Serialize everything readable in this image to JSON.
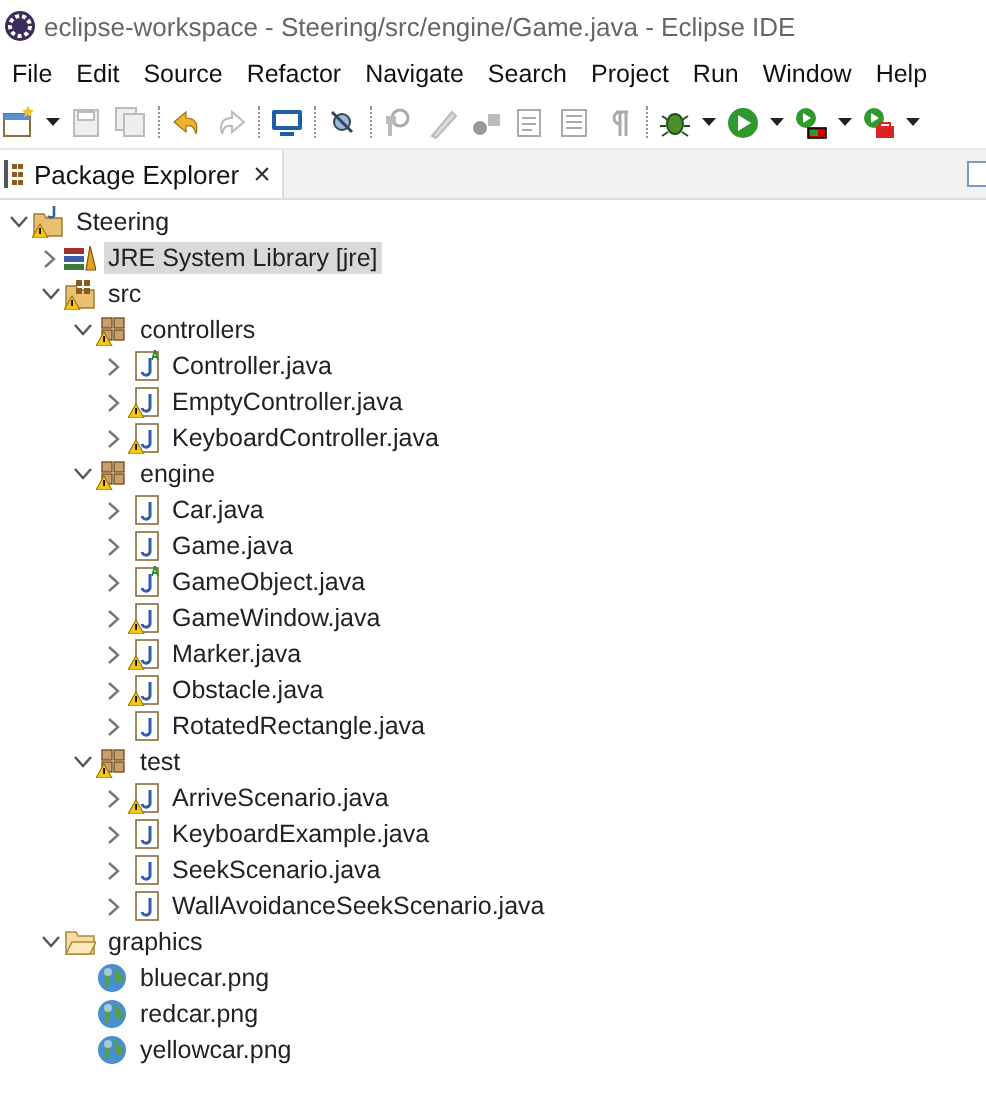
{
  "window": {
    "title": "eclipse-workspace - Steering/src/engine/Game.java - Eclipse IDE"
  },
  "menu": [
    "File",
    "Edit",
    "Source",
    "Refactor",
    "Navigate",
    "Search",
    "Project",
    "Run",
    "Window",
    "Help"
  ],
  "view_tab": {
    "label": "Package Explorer",
    "close": "×"
  },
  "tree": [
    {
      "label": "Steering",
      "kind": "project",
      "expanded": true,
      "warning": true,
      "selected": false,
      "children": [
        {
          "label": "JRE System Library [jre]",
          "kind": "library",
          "expanded": false,
          "warning": false,
          "selected": true
        },
        {
          "label": "src",
          "kind": "srcfolder",
          "expanded": true,
          "warning": true,
          "selected": false,
          "children": [
            {
              "label": "controllers",
              "kind": "package",
              "expanded": true,
              "warning": true,
              "selected": false,
              "children": [
                {
                  "label": "Controller.java",
                  "kind": "abstract",
                  "expanded": false,
                  "warning": false,
                  "selected": false
                },
                {
                  "label": "EmptyController.java",
                  "kind": "java",
                  "expanded": false,
                  "warning": true,
                  "selected": false
                },
                {
                  "label": "KeyboardController.java",
                  "kind": "java",
                  "expanded": false,
                  "warning": true,
                  "selected": false
                }
              ]
            },
            {
              "label": "engine",
              "kind": "package",
              "expanded": true,
              "warning": true,
              "selected": false,
              "children": [
                {
                  "label": "Car.java",
                  "kind": "java",
                  "expanded": false,
                  "warning": false,
                  "selected": false
                },
                {
                  "label": "Game.java",
                  "kind": "java",
                  "expanded": false,
                  "warning": false,
                  "selected": false
                },
                {
                  "label": "GameObject.java",
                  "kind": "abstract",
                  "expanded": false,
                  "warning": false,
                  "selected": false
                },
                {
                  "label": "GameWindow.java",
                  "kind": "java",
                  "expanded": false,
                  "warning": true,
                  "selected": false
                },
                {
                  "label": "Marker.java",
                  "kind": "java",
                  "expanded": false,
                  "warning": true,
                  "selected": false
                },
                {
                  "label": "Obstacle.java",
                  "kind": "java",
                  "expanded": false,
                  "warning": true,
                  "selected": false
                },
                {
                  "label": "RotatedRectangle.java",
                  "kind": "java",
                  "expanded": false,
                  "warning": false,
                  "selected": false
                }
              ]
            },
            {
              "label": "test",
              "kind": "package",
              "expanded": true,
              "warning": true,
              "selected": false,
              "children": [
                {
                  "label": "ArriveScenario.java",
                  "kind": "java",
                  "expanded": false,
                  "warning": true,
                  "selected": false
                },
                {
                  "label": "KeyboardExample.java",
                  "kind": "java",
                  "expanded": false,
                  "warning": false,
                  "selected": false
                },
                {
                  "label": "SeekScenario.java",
                  "kind": "java",
                  "expanded": false,
                  "warning": false,
                  "selected": false
                },
                {
                  "label": "WallAvoidanceSeekScenario.java",
                  "kind": "java",
                  "expanded": false,
                  "warning": false,
                  "selected": false
                }
              ]
            }
          ]
        },
        {
          "label": "graphics",
          "kind": "folder",
          "expanded": true,
          "warning": false,
          "selected": false,
          "children": [
            {
              "label": "bluecar.png",
              "kind": "image",
              "warning": false,
              "selected": false
            },
            {
              "label": "redcar.png",
              "kind": "image",
              "warning": false,
              "selected": false
            },
            {
              "label": "yellowcar.png",
              "kind": "image",
              "warning": false,
              "selected": false
            }
          ]
        }
      ]
    }
  ]
}
